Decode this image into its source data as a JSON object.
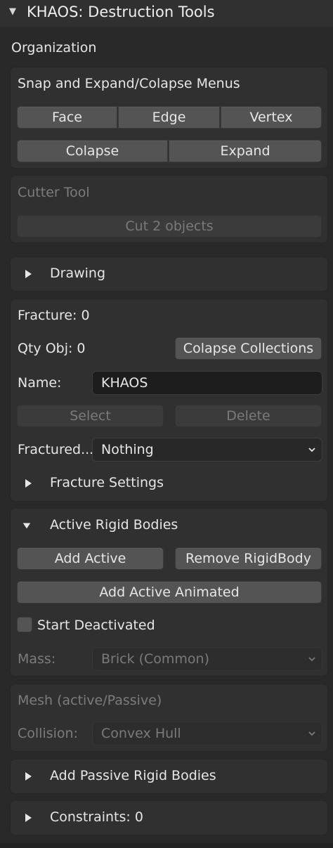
{
  "panel": {
    "title": "KHAOS: Destruction Tools",
    "section_label": "Organization"
  },
  "snap": {
    "label": "Snap and Expand/Colapse Menus",
    "face": "Face",
    "edge": "Edge",
    "vertex": "Vertex",
    "colapse": "Colapse",
    "expand": "Expand"
  },
  "cutter": {
    "label": "Cutter Tool",
    "cut_button": "Cut 2 objects"
  },
  "drawing": {
    "label": "Drawing"
  },
  "fracture": {
    "fracture_label": "Fracture: 0",
    "qty_label": "Qty Obj: 0",
    "colapse_collections": "Colapse Collections",
    "name_label": "Name:",
    "name_value": "KHAOS",
    "select": "Select",
    "delete": "Delete",
    "fractured_label": "Fractured...",
    "fractured_value": "Nothing",
    "settings_label": "Fracture Settings"
  },
  "active_rigid": {
    "label": "Active Rigid Bodies",
    "add_active": "Add Active",
    "remove_rigidbody": "Remove RigidBody",
    "add_active_animated": "Add Active Animated",
    "start_deactivated": "Start Deactivated",
    "mass_label": "Mass:",
    "mass_value": "Brick (Common)"
  },
  "mesh": {
    "label": "Mesh (active/Passive)",
    "collision_label": "Collision:",
    "collision_value": "Convex Hull"
  },
  "passive": {
    "label": "Add Passive Rigid Bodies"
  },
  "constraints": {
    "label": "Constraints: 0"
  },
  "colors": {
    "background": "#292929",
    "box": "#303030",
    "button": "#545454",
    "text": "#e6e6e6",
    "disabled_text": "#7a7a7a"
  }
}
